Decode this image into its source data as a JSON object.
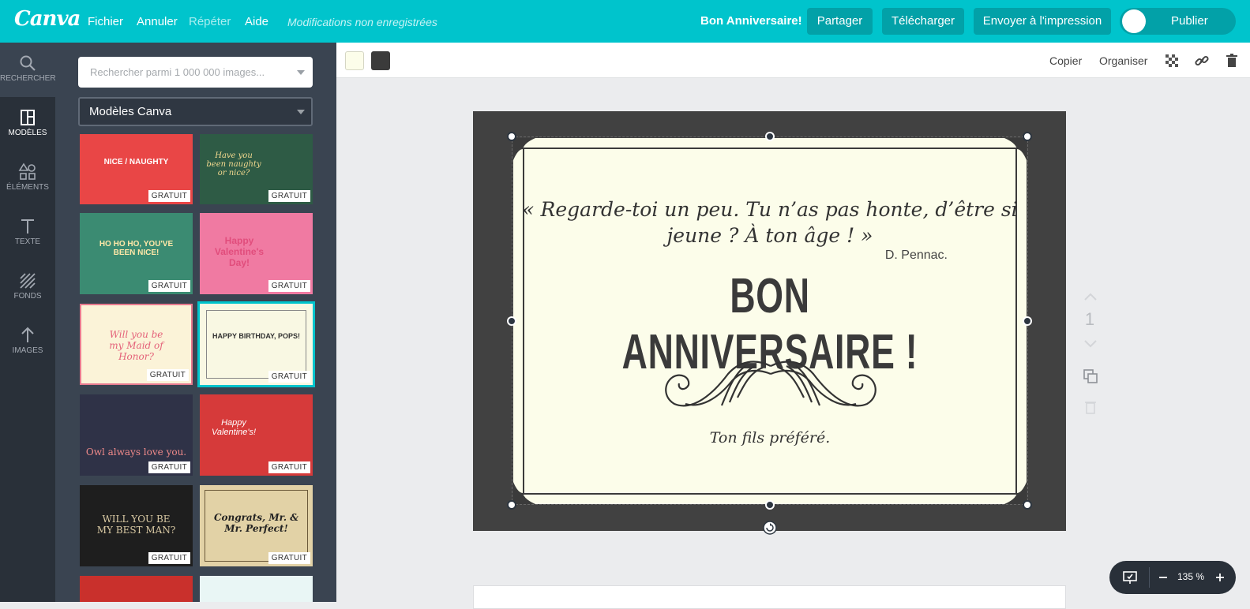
{
  "app": {
    "logo": "Canva",
    "menu": [
      "Fichier",
      "Annuler",
      "Répéter",
      "Aide"
    ],
    "unsaved_status": "Modifications non enregistrées",
    "doc_title": "Bon Anniversaire!",
    "buttons": {
      "share": "Partager",
      "download": "Télécharger",
      "print": "Envoyer à l'impression",
      "publish": "Publier"
    },
    "accent_color": "#00c4cc"
  },
  "rail": [
    {
      "label": "RECHERCHER",
      "icon": "search-icon"
    },
    {
      "label": "MODÈLES",
      "icon": "layout-icon",
      "active": true
    },
    {
      "label": "ÉLÉMENTS",
      "icon": "shapes-icon"
    },
    {
      "label": "TEXTE",
      "icon": "text-icon"
    },
    {
      "label": "FONDS",
      "icon": "background-icon"
    },
    {
      "label": "IMAGES",
      "icon": "upload-icon"
    }
  ],
  "panel": {
    "search_placeholder": "Rechercher parmi 1 000 000 images...",
    "category": "Modèles Canva",
    "badge": "GRATUIT",
    "templates": [
      {
        "text": "NICE / NAUGHTY",
        "bg": "#e94646",
        "fg": "#ffffff"
      },
      {
        "text": "Have you been naughty or nice?",
        "bg": "#2e5b45",
        "fg": "#f3d98f"
      },
      {
        "text": "HO HO HO, YOU'VE BEEN NICE!",
        "bg": "#3b8b72",
        "fg": "#ffe8a8"
      },
      {
        "text": "Happy Valentine's Day!",
        "bg": "#f07aa2",
        "fg": "#e14d7c"
      },
      {
        "text": "Will you be my Maid of Honor?",
        "bg": "#fbf3d8",
        "fg": "#e4627a"
      },
      {
        "text": "HAPPY BIRTHDAY, POPS!",
        "bg": "#f9f8e3",
        "fg": "#333333"
      },
      {
        "text": "Owl always love you.",
        "bg": "#2f3247",
        "fg": "#f08a8a"
      },
      {
        "text": "Happy Valentine's!",
        "bg": "#d63a3a",
        "fg": "#ffffff"
      },
      {
        "text": "WILL YOU BE MY BEST MAN?",
        "bg": "#1e1e1e",
        "fg": "#d9c9a3"
      },
      {
        "text": "Congrats, Mr. & Mr. Perfect!",
        "bg": "#e2d2a6",
        "fg": "#222222"
      }
    ]
  },
  "context_bar": {
    "swatches": [
      "#fcfdea",
      "#3b3b3b"
    ],
    "copy": "Copier",
    "arrange": "Organiser"
  },
  "card": {
    "quote": "« Regarde-toi un peu. Tu n’as pas honte, d’être si jeune ? À ton âge ! »",
    "author": "D. Pennac.",
    "headline": "BON ANNIVERSAIRE !",
    "signature": "Ton fils préféré."
  },
  "page_controls": {
    "page_number": "1"
  },
  "zoom": {
    "level": "135 %"
  }
}
